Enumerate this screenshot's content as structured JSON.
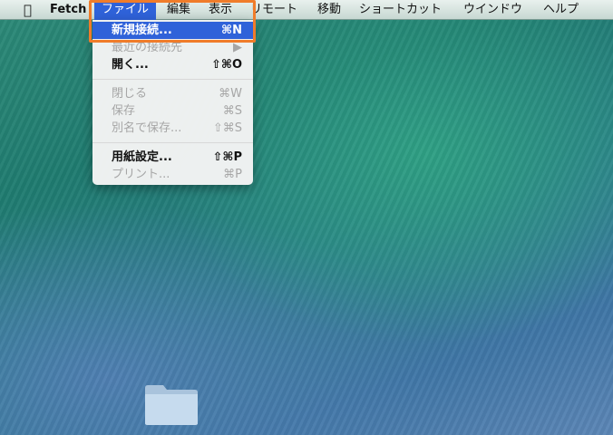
{
  "menubar": {
    "app": "Fetch",
    "items": [
      "ファイル",
      "編集",
      "表示",
      "リモート",
      "移動",
      "ショートカット",
      "ウインドウ",
      "ヘルプ"
    ]
  },
  "file_menu": {
    "new_connection": {
      "label": "新規接続...",
      "shortcut": "⌘N"
    },
    "recent": {
      "label": "最近の接続先",
      "shortcut": "▶"
    },
    "open": {
      "label": "開く...",
      "shortcut": "⇧⌘O"
    },
    "close": {
      "label": "閉じる",
      "shortcut": "⌘W"
    },
    "save": {
      "label": "保存",
      "shortcut": "⌘S"
    },
    "save_as": {
      "label": "別名で保存...",
      "shortcut": "⇧⌘S"
    },
    "page_setup": {
      "label": "用紙設定...",
      "shortcut": "⇧⌘P"
    },
    "print": {
      "label": "プリント...",
      "shortcut": "⌘P"
    }
  },
  "highlight_color": "#f07c2a"
}
